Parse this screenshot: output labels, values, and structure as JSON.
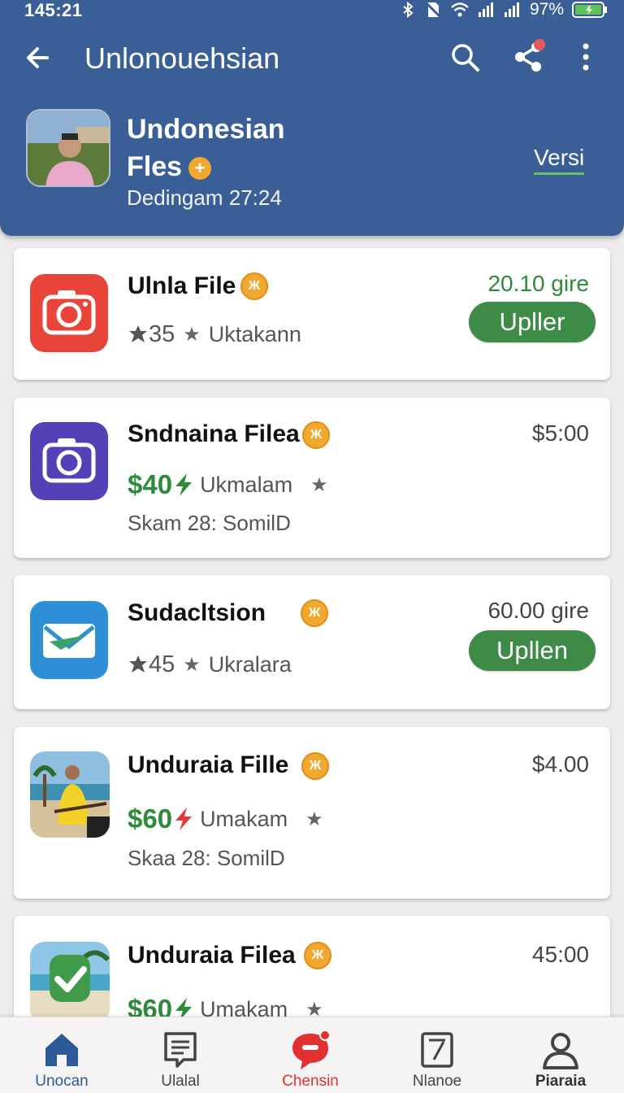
{
  "status_bar": {
    "time": "145:21",
    "battery": "97%"
  },
  "app_bar": {
    "title": "Unlonouehsian"
  },
  "profile": {
    "name_line1": "Undonesian",
    "name_line2": "Fles",
    "plus_badge": "+",
    "subtitle": "Dedingam 27:24",
    "link": "Versi"
  },
  "cards": [
    {
      "title": "Ulnla File",
      "coin": "Ж",
      "count": "35",
      "label": "Uktakann",
      "right_text": "20.10 gire",
      "button": "Upller"
    },
    {
      "title": "Sndnaina Filea",
      "coin": "Ж",
      "price": "$40",
      "label": "Ukmalam",
      "sub": "Skam 28: SomilD",
      "right_text": "$5:00"
    },
    {
      "title": "Sudacltsion",
      "coin": "Ж",
      "count": "45",
      "label": "Ukralara",
      "right_text": "60.00 gire",
      "button": "Upllen"
    },
    {
      "title": "Unduraia Fille",
      "coin": "Ж",
      "price": "$60",
      "label": "Umakam",
      "sub": "Skaa 28: SomilD",
      "right_text": "$4.00"
    },
    {
      "title": "Unduraia Filea",
      "coin": "Ж",
      "price": "$60",
      "label": "Umakam",
      "right_text": "45:00"
    }
  ],
  "bottom_nav": [
    {
      "label": "Unocan",
      "icon": "home-icon"
    },
    {
      "label": "Ulalal",
      "icon": "document-icon"
    },
    {
      "label": "Chensin",
      "icon": "chat-icon"
    },
    {
      "label": "Nlanoe",
      "icon": "edit-icon"
    },
    {
      "label": "Piaraia",
      "icon": "profile-icon"
    }
  ],
  "colors": {
    "header": "#3a5f96",
    "accent_green": "#3d8b47",
    "price_green": "#2e8b3a",
    "coin": "#f0a830",
    "active_nav": "#2d5b97",
    "red": "#d33333"
  }
}
